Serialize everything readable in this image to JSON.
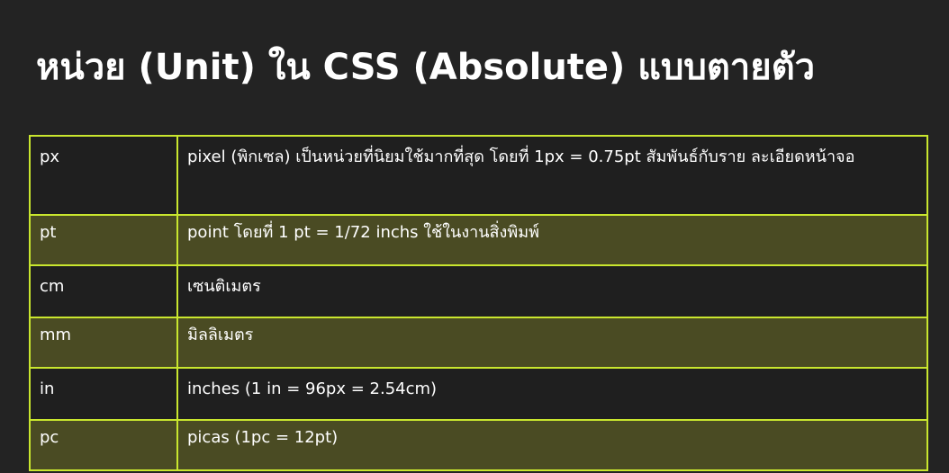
{
  "slide": {
    "title": "หน่วย (Unit) ใน CSS (Absolute) แบบตายตัว"
  },
  "table": {
    "rows": [
      {
        "unit": "px",
        "description": "pixel (พิกเซล) เป็นหน่วยที่นิยมใช้มากที่สุด โดยที่ 1px = 0.75pt สัมพันธ์กับราย ละเอียดหน้าจอ"
      },
      {
        "unit": "pt",
        "description": "point โดยที่ 1 pt = 1/72 inchs ใช้ในงานสิ่งพิมพ์"
      },
      {
        "unit": "cm",
        "description": "เซนติเมตร"
      },
      {
        "unit": "mm",
        "description": "มิลลิเมตร"
      },
      {
        "unit": "in",
        "description": "inches (1 in = 96px = 2.54cm)"
      },
      {
        "unit": "pc",
        "description": "picas (1pc = 12pt)"
      }
    ]
  },
  "colors": {
    "background": "#232323",
    "border_accent": "#c9e62e",
    "row_dark": "#1f1f1f",
    "row_olive": "#4a4b23",
    "text": "#ffffff"
  }
}
